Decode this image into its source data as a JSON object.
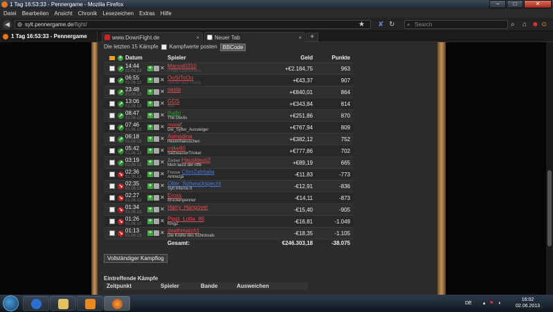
{
  "window": {
    "title": "1 Tag 16:53:33 - Pennergame - Mozilla Firefox"
  },
  "menu": [
    "Datei",
    "Bearbeiten",
    "Ansicht",
    "Chronik",
    "Lesezeichen",
    "Extras",
    "Hilfe"
  ],
  "url": {
    "host": "sylt.pennergame.de",
    "path": "/fight/"
  },
  "search": {
    "placeholder": "Search"
  },
  "tabs": [
    {
      "label": "1 Tag 16:53:33 - Pennergame"
    },
    {
      "label": "www.DownFight.de"
    },
    {
      "label": "Neuer Tab"
    }
  ],
  "page": {
    "last_fights": "Die letzten 15 Kämpfe",
    "post_label": "Kampfwerte posten",
    "bbcode": "BBCode",
    "headers": {
      "date": "Datum",
      "player": "Spieler",
      "money": "Geld",
      "points": "Punkte"
    },
    "rows": [
      {
        "time": "14:44",
        "date": "02.06.13",
        "pre": "",
        "name": "Marsol0310",
        "band": "Pirate Connection",
        "money": "+€2.184,75",
        "points": "963",
        "result": "win",
        "color": "red",
        "dim": true
      },
      {
        "time": "06:55",
        "date": "02.06.13",
        "pre": "",
        "name": "OoStToOo",
        "band": "Gomar and Sandy",
        "money": "+€43,37",
        "points": "907",
        "result": "win",
        "color": "red",
        "dim": true
      },
      {
        "time": "23:48",
        "date": "01.06.13",
        "pre": "",
        "name": "sasta",
        "band": "",
        "money": "+€840,01",
        "points": "864",
        "result": "win",
        "color": "red",
        "dim": false
      },
      {
        "time": "13:06",
        "date": "01.06.13",
        "pre": "",
        "name": "GDS",
        "band": "404",
        "money": "+€343,84",
        "points": "814",
        "result": "win",
        "color": "red",
        "dim": true
      },
      {
        "time": "08:47",
        "date": "01.06.13",
        "pre": "",
        "name": "thallo",
        "band": "The Devils",
        "money": "+€251,86",
        "points": "870",
        "result": "win",
        "color": "green",
        "dim": false
      },
      {
        "time": "07:46",
        "date": "01.06.13",
        "pre": "",
        "name": "mwalf",
        "band": "Die_Sylter_Aussteiger",
        "money": "+€767,94",
        "points": "809",
        "result": "win",
        "color": "red",
        "dim": false
      },
      {
        "time": "06:18",
        "date": "01.06.13",
        "pre": "",
        "name": "Asmodina",
        "band": "Hexenhaeuschen",
        "money": "+€382,12",
        "points": "752",
        "result": "win",
        "color": "red",
        "dim": false
      },
      {
        "time": "05:42",
        "date": "01.06.13",
        "pre": "",
        "name": "mike80",
        "band": "SalzwasserTrinker",
        "money": "+€777,86",
        "points": "702",
        "result": "win",
        "color": "red",
        "dim": false
      },
      {
        "time": "03:19",
        "date": "01.06.13",
        "pre": "Zocker",
        "name": "Hausklaus2",
        "band": "Mich laust der Affe",
        "money": "+€89,19",
        "points": "665",
        "result": "win",
        "color": "red",
        "dim": false
      },
      {
        "time": "02:36",
        "date": "01.06.13",
        "pre": "Fresse",
        "name": "CitroZabitalia",
        "band": "Amnezja",
        "money": "-€11,83",
        "points": "-773",
        "result": "loss",
        "color": "blue",
        "dim": false
      },
      {
        "time": "02:35",
        "date": "01.06.13",
        "pre": "",
        "name": "Olter_Schwuckspecht",
        "band": "Sylt Inferno II",
        "money": "-€12,91",
        "points": "-836",
        "result": "loss",
        "color": "blue",
        "dim": false
      },
      {
        "time": "02:27",
        "date": "01.06.13",
        "pre": "",
        "name": "Eross",
        "band": "Brückenpenner",
        "money": "-€14,11",
        "points": "-873",
        "result": "loss",
        "color": "red",
        "dim": false
      },
      {
        "time": "01:34",
        "date": "01.06.13",
        "pre": "",
        "name": "Harry_Hangover",
        "band": "",
        "money": "-€15,40",
        "points": "-905",
        "result": "loss",
        "color": "red",
        "dim": false
      },
      {
        "time": "01:26",
        "date": "01.06.13",
        "pre": "",
        "name": "Pippi_Lotta_86",
        "band": "KingZ",
        "money": "-€16,81",
        "points": "-1.049",
        "result": "loss",
        "color": "red",
        "dim": false
      },
      {
        "time": "01:13",
        "date": "01.06.13",
        "pre": "",
        "name": "deathmatch1",
        "band": "Die Kräfte des Schicksals",
        "money": "-€18,35",
        "points": "-1.105",
        "result": "loss",
        "color": "red",
        "dim": false
      }
    ],
    "total_label": "Gesamt:",
    "total_money": "€246.303,18",
    "total_points": "-38.075",
    "full_log": "Vollständiger Kampflog",
    "incoming_title": "Eintreffende Kämpfe",
    "incoming_headers": {
      "time": "Zeitpunkt",
      "player": "Spieler",
      "band": "Bande",
      "evade": "Ausweichen"
    }
  },
  "taskbar": {
    "lang": "DE",
    "time": "16:02",
    "date": "02.06.2013"
  }
}
